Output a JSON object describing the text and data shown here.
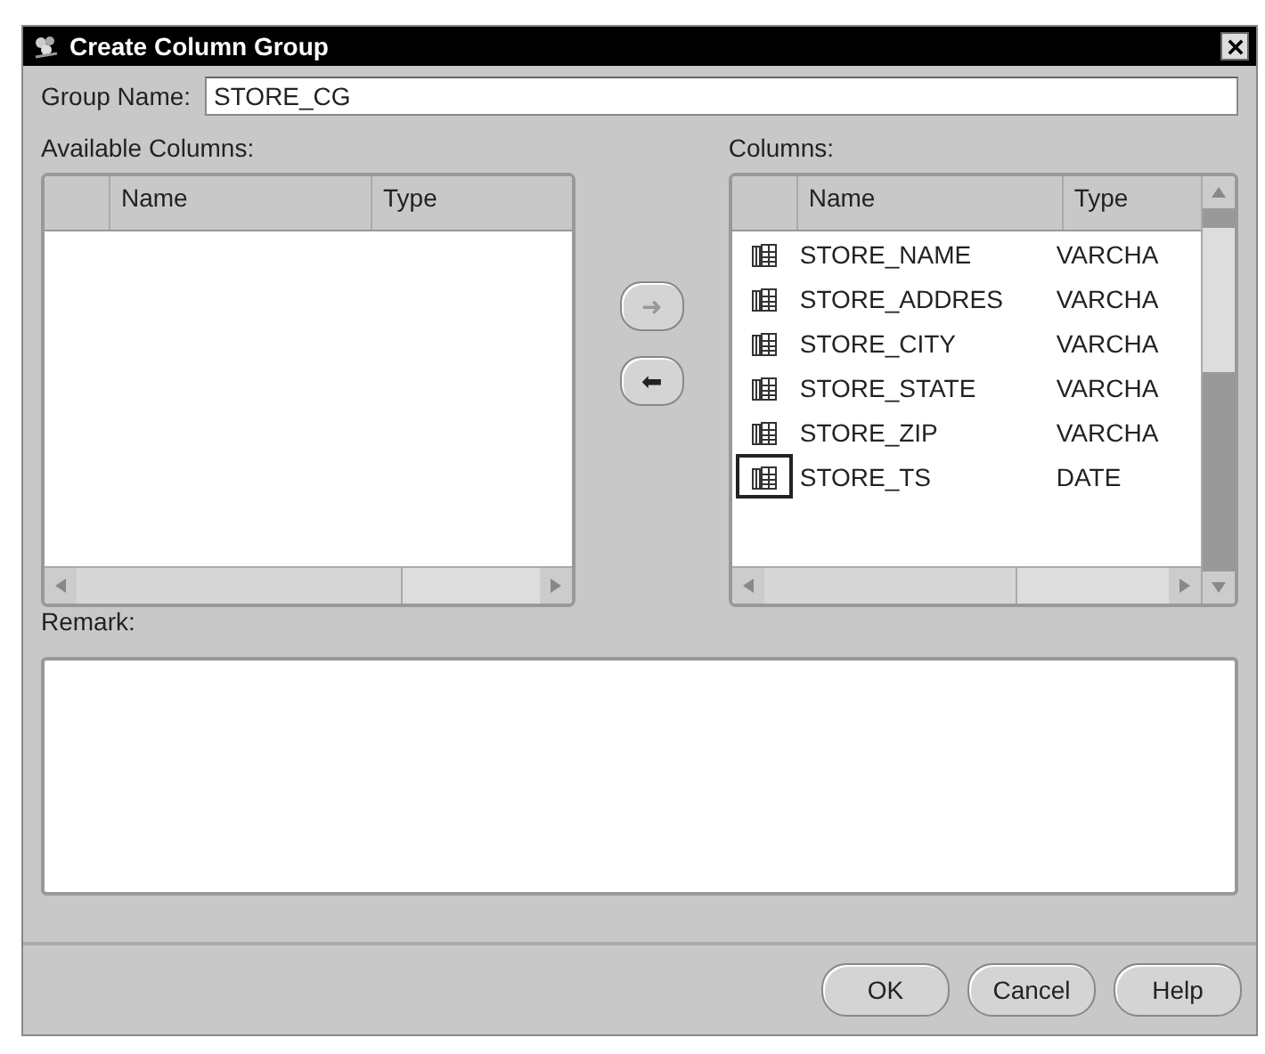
{
  "window": {
    "title": "Create Column Group"
  },
  "group_name": {
    "label": "Group Name:",
    "value": "STORE_CG"
  },
  "available_columns": {
    "label": "Available Columns:",
    "columns": [
      "Name",
      "Type"
    ]
  },
  "move_buttons": [
    {
      "glyph": "➜",
      "disabled": true
    },
    {
      "glyph": "⬅",
      "disabled": false
    }
  ],
  "columns": {
    "label": "Columns:",
    "columns": [
      "Name",
      "Type"
    ],
    "rows": [
      {
        "name": "STORE_NAME",
        "type": "VARCHA",
        "focused": false
      },
      {
        "name": "STORE_ADDRES",
        "type": "VARCHA",
        "focused": false
      },
      {
        "name": "STORE_CITY",
        "type": "VARCHA",
        "focused": false
      },
      {
        "name": "STORE_STATE",
        "type": "VARCHA",
        "focused": false
      },
      {
        "name": "STORE_ZIP",
        "type": "VARCHA",
        "focused": false
      },
      {
        "name": "STORE_TS",
        "type": "DATE",
        "focused": true
      }
    ]
  },
  "remark": {
    "label": "Remark:"
  },
  "buttons": [
    "OK",
    "Cancel",
    "Help"
  ]
}
